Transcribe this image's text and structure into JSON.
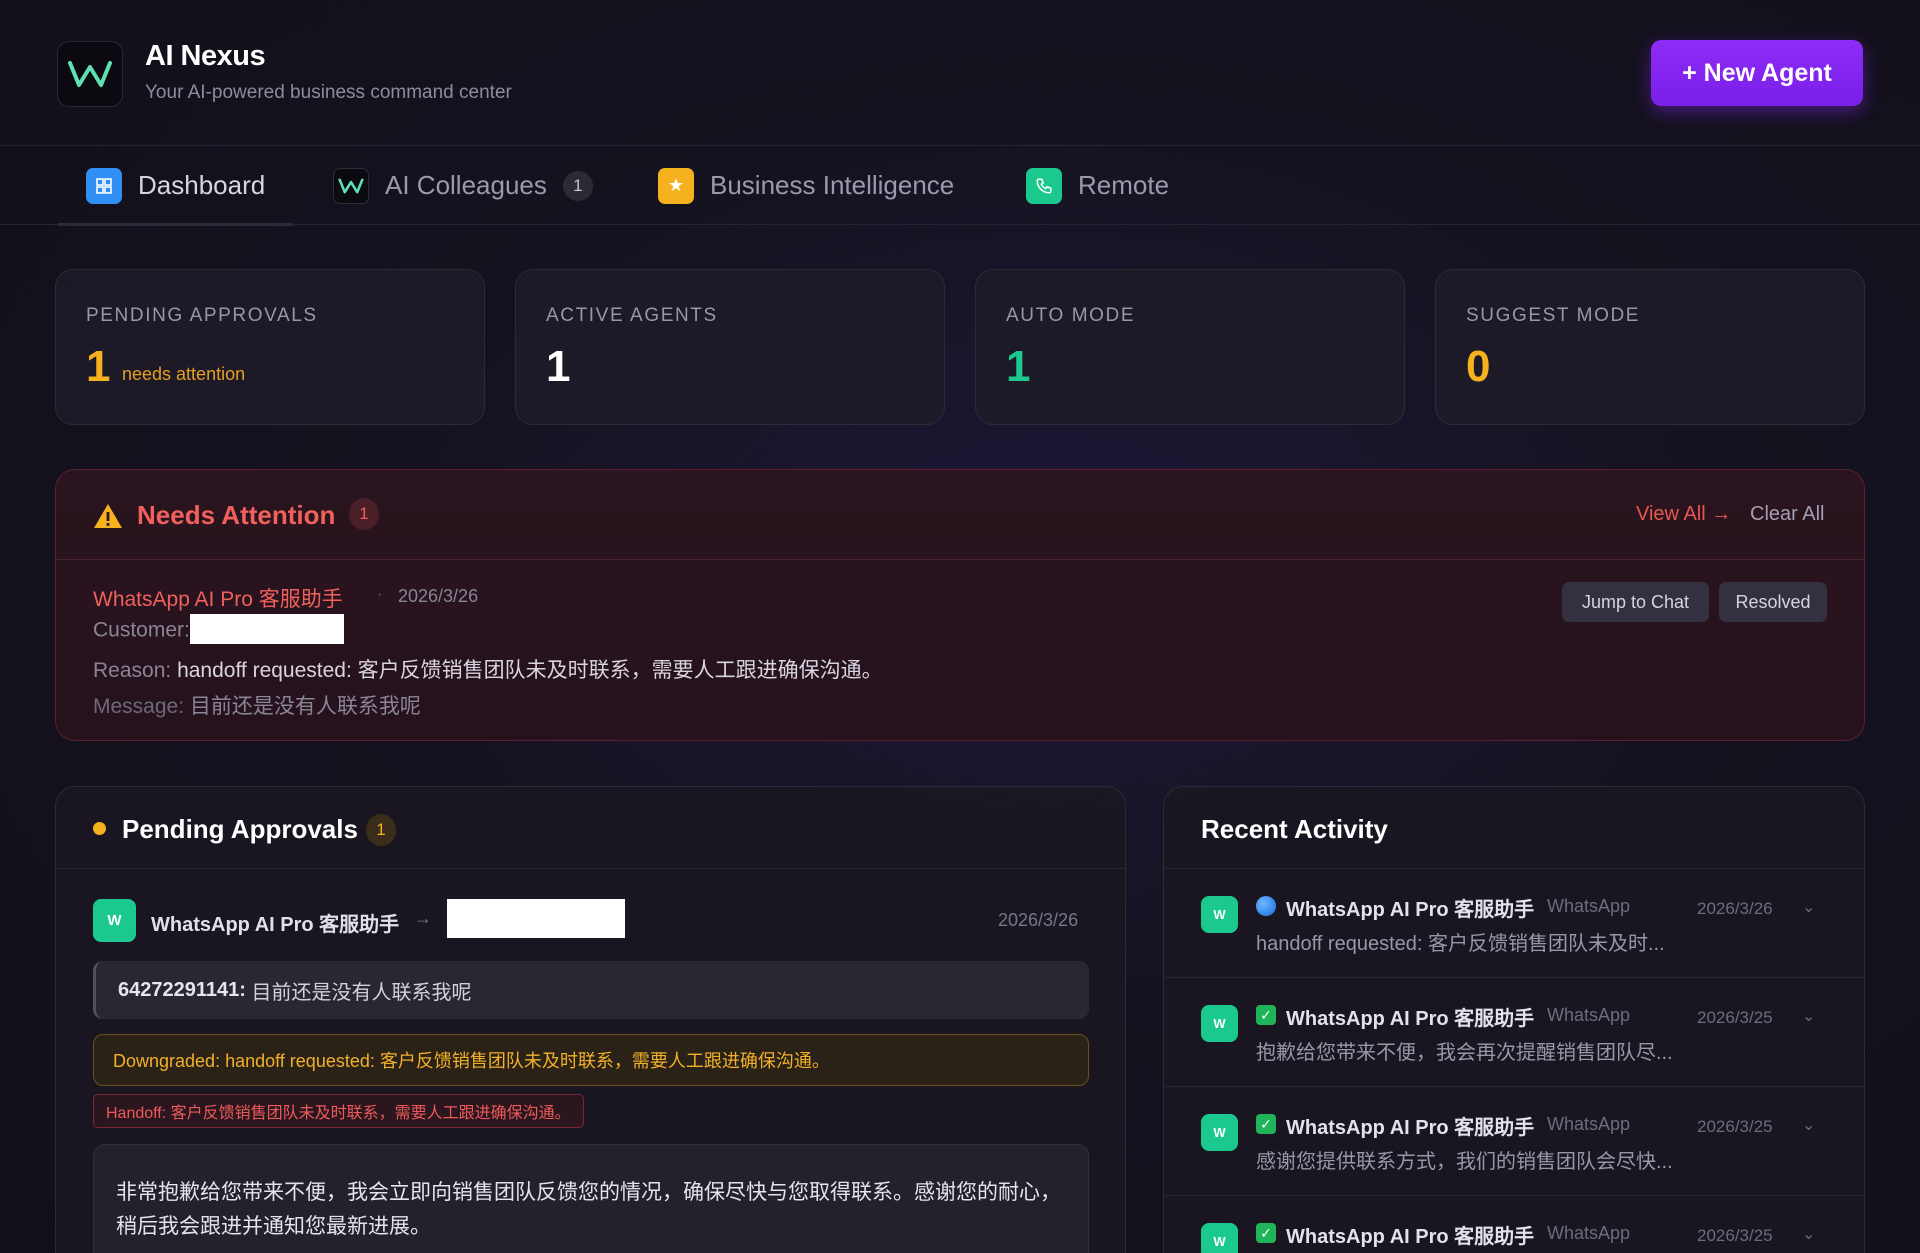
{
  "app": {
    "title": "AI Nexus",
    "subtitle": "Your AI-powered business command center",
    "new_agent_label": "+ New Agent"
  },
  "tabs": [
    {
      "label": "Dashboard",
      "icon": "grid-icon",
      "active": true
    },
    {
      "label": "AI Colleagues",
      "icon": "w-logo-icon",
      "badge": "1"
    },
    {
      "label": "Business Intelligence",
      "icon": "star-icon"
    },
    {
      "label": "Remote",
      "icon": "phone-icon"
    }
  ],
  "stats": [
    {
      "label": "PENDING APPROVALS",
      "value": "1",
      "note": "needs attention",
      "color": "#f6b11e"
    },
    {
      "label": "ACTIVE AGENTS",
      "value": "1",
      "color": "#ffffff"
    },
    {
      "label": "AUTO MODE",
      "value": "1",
      "color": "#1bc98e"
    },
    {
      "label": "SUGGEST MODE",
      "value": "0",
      "color": "#f6b11e"
    }
  ],
  "attention": {
    "title": "Needs Attention",
    "badge": "1",
    "view_all": "View All →",
    "clear_all": "Clear All",
    "item": {
      "agent": "WhatsApp AI Pro 客服助手",
      "dot": "·",
      "date": "2026/3/26",
      "customer_label": "Customer:",
      "reason_label": "Reason:",
      "reason": "handoff requested: 客户反馈销售团队未及时联系，需要人工跟进确保沟通。",
      "message_label": "Message:",
      "message": "目前还是没有人联系我呢",
      "jump_label": "Jump to Chat",
      "resolved_label": "Resolved"
    }
  },
  "pending": {
    "title": "Pending Approvals",
    "badge": "1",
    "item": {
      "icon_letter": "W",
      "agent": "WhatsApp AI Pro 客服助手",
      "arrow": "→",
      "date": "2026/3/26",
      "quote_sender": "64272291141:",
      "quote_text": "目前还是没有人联系我呢",
      "downgraded": "Downgraded: handoff requested: 客户反馈销售团队未及时联系，需要人工跟进确保沟通。",
      "handoff": "Handoff: 客户反馈销售团队未及时联系，需要人工跟进确保沟通。",
      "reply": "非常抱歉给您带来不便，我会立即向销售团队反馈您的情况，确保尽快与您取得联系。感谢您的耐心，稍后我会跟进并通知您最新进展。"
    }
  },
  "recent": {
    "title": "Recent Activity",
    "items": [
      {
        "icon_letter": "W",
        "status": "blue-dot-icon",
        "agent": "WhatsApp AI Pro 客服助手",
        "channel": "WhatsApp",
        "date": "2026/3/26",
        "text": "handoff requested: 客户反馈销售团队未及时..."
      },
      {
        "icon_letter": "W",
        "status": "check-icon",
        "agent": "WhatsApp AI Pro 客服助手",
        "channel": "WhatsApp",
        "date": "2026/3/25",
        "text": "抱歉给您带来不便，我会再次提醒销售团队尽..."
      },
      {
        "icon_letter": "W",
        "status": "check-icon",
        "agent": "WhatsApp AI Pro 客服助手",
        "channel": "WhatsApp",
        "date": "2026/3/25",
        "text": "感谢您提供联系方式，我们的销售团队会尽快..."
      },
      {
        "icon_letter": "W",
        "status": "check-icon",
        "agent": "WhatsApp AI Pro 客服助手",
        "channel": "WhatsApp",
        "date": "2026/3/25",
        "text": ""
      }
    ]
  }
}
